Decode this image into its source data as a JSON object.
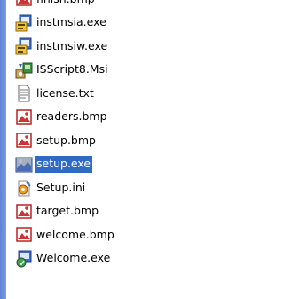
{
  "files": [
    {
      "name": "finish.bmp",
      "icon": "bitmap-icon"
    },
    {
      "name": "instmsia.exe",
      "icon": "installer-exe-icon"
    },
    {
      "name": "instmsiw.exe",
      "icon": "installer-exe-icon"
    },
    {
      "name": "ISScript8.Msi",
      "icon": "msi-package-icon"
    },
    {
      "name": "license.txt",
      "icon": "text-document-icon"
    },
    {
      "name": "readers.bmp",
      "icon": "bitmap-icon"
    },
    {
      "name": "setup.bmp",
      "icon": "bitmap-icon"
    },
    {
      "name": "setup.exe",
      "icon": "setup-program-icon",
      "selected": true
    },
    {
      "name": "Setup.ini",
      "icon": "ini-settings-icon"
    },
    {
      "name": "target.bmp",
      "icon": "bitmap-icon"
    },
    {
      "name": "welcome.bmp",
      "icon": "bitmap-icon"
    },
    {
      "name": "Welcome.exe",
      "icon": "program-exe-icon"
    }
  ],
  "colors": {
    "selection_bg": "#316ac5",
    "selection_text": "#ffffff",
    "left_strip": "#6f8fdb"
  }
}
